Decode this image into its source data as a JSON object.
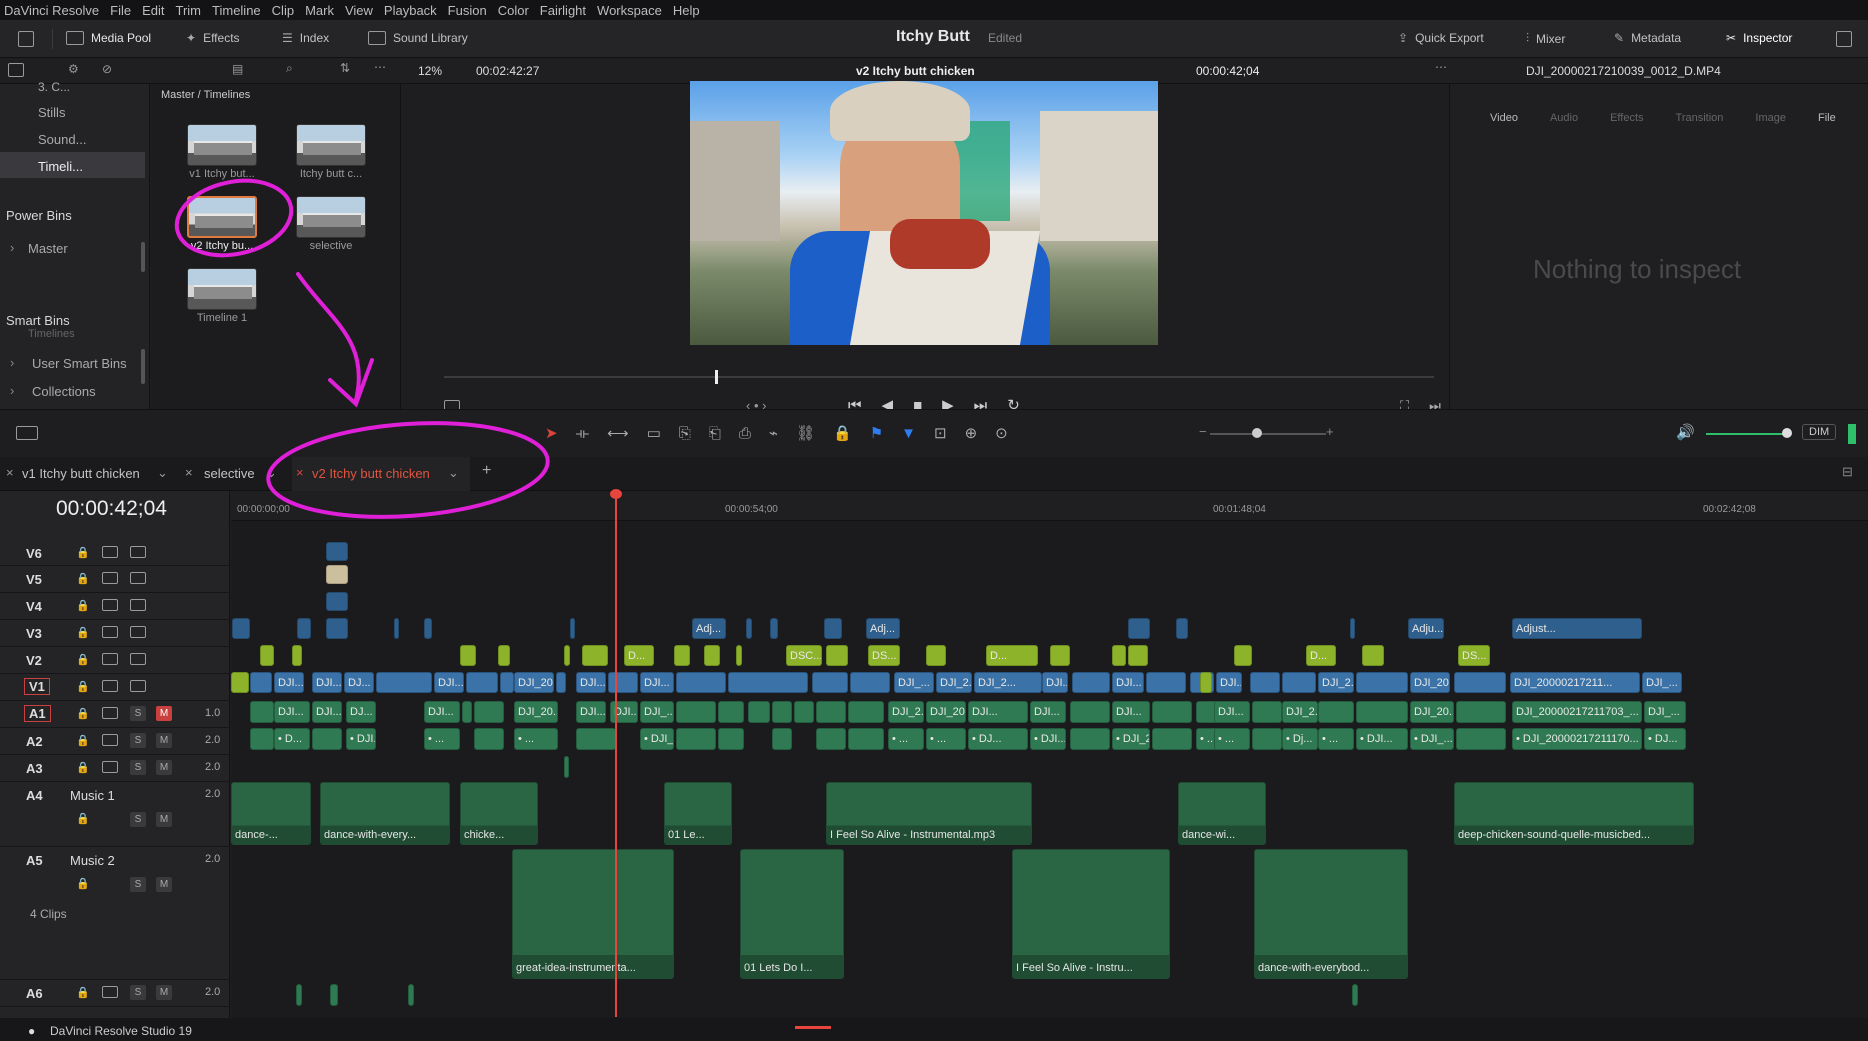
{
  "menu": [
    "DaVinci Resolve",
    "File",
    "Edit",
    "Trim",
    "Timeline",
    "Clip",
    "Mark",
    "View",
    "Playback",
    "Fusion",
    "Color",
    "Fairlight",
    "Workspace",
    "Help"
  ],
  "toolbar": {
    "media_pool": "Media Pool",
    "effects": "Effects",
    "index": "Index",
    "sound_library": "Sound Library",
    "project_title": "Itchy Butt",
    "project_status": "Edited",
    "quick_export": "Quick Export",
    "mixer": "Mixer",
    "metadata": "Metadata",
    "inspector": "Inspector"
  },
  "subbar": {
    "zoom": "12%",
    "source_timecode": "00:02:42:27",
    "timeline_name": "v2 Itchy butt chicken",
    "record_timecode": "00:00:42;04",
    "clip_name": "DJI_20000217210039_0012_D.MP4"
  },
  "sidebar": {
    "item_top": "3. C...",
    "stills": "Stills",
    "sound": "Sound...",
    "timelines": "Timeli...",
    "power_bins": "Power Bins",
    "master": "Master",
    "smart_bins": "Smart Bins",
    "user_smart_bins": "User Smart Bins",
    "collections": "Collections",
    "timelines_hidden": "Timelines"
  },
  "pool": {
    "path": "Master / Timelines",
    "items": [
      "v1 Itchy but...",
      "Itchy butt c...",
      "v2 Itchy bu...",
      "selective",
      "Timeline 1"
    ]
  },
  "inspector_panel": {
    "tabs": [
      "Video",
      "Audio",
      "Effects",
      "Transition",
      "Image",
      "File"
    ],
    "empty": "Nothing to inspect"
  },
  "timeline_tools": {
    "dim": "DIM"
  },
  "tabs": {
    "tab1": "v1 Itchy butt chicken",
    "tab2": "selective",
    "tab3": "v2 Itchy butt chicken",
    "add": "+"
  },
  "timecode": "00:00:42;04",
  "ruler": [
    "00:00:00;00",
    "00:00:54;00",
    "00:01:48;04",
    "00:02:42;08"
  ],
  "tracks": {
    "V6": "V6",
    "V5": "V5",
    "V4": "V4",
    "V3": "V3",
    "V2": "V2",
    "V1": "V1",
    "A1": "A1",
    "A2": "A2",
    "A3": "A3",
    "A4": "A4",
    "A5": "A5",
    "A6": "A6",
    "a1_level": "1.0",
    "a2_level": "2.0",
    "a3_level": "2.0",
    "a4_level": "2.0",
    "a5_level": "2.0",
    "a6_level": "2.0",
    "a4_name": "Music 1",
    "a5_name": "Music 2",
    "a5_clips": "4 Clips"
  },
  "clip_labels": {
    "adj1": "Adj...",
    "adj2": "Adj...",
    "adju": "Adju...",
    "adjust": "Adjust...",
    "v2_d1": "D...",
    "v2_dsc": "DSC...",
    "v2_ds": "DS...",
    "v2_d2": "D...",
    "v2_d3": "D...",
    "v2_d4": "D...",
    "v2_ds2": "DS...",
    "v1_1": "DJI...",
    "v1_2": "DJI...",
    "v1_3": "DJ...",
    "v1_4": "DJI...",
    "v1_5": "DJI_20...",
    "v1_6": "DJI...",
    "v1_7": "DJI...",
    "v1_8": "DJI_...",
    "v1_9": "DJI_2...",
    "v1_10": "DJI_2...",
    "v1_11": "DJI...",
    "v1_12": "DJI...",
    "v1_13": "DJI...",
    "v1_14": "DJI_2...",
    "v1_15": "DJI_20...",
    "v1_16": "DJI_20000217211...",
    "v1_17": "DJI_...",
    "a1_1": "DJI...",
    "a1_2": "DJI...",
    "a1_3": "DJ...",
    "a1_4": "DJI...",
    "a1_5": "DJI_20...",
    "a1_6": "DJI...",
    "a1_7": "DJI...",
    "a1_8": "DJI_...",
    "a1_9": "DJI_2...",
    "a1_10": "DJI_2000...",
    "a1_11": "DJI...",
    "a1_12": "DJI...",
    "a1_13": "DJI...",
    "a1_14": "DJI...",
    "a1_15": "DJI_2...",
    "a1_16": "DJI_20...",
    "a1_17": "DJI_20000217211703_...",
    "a1_18": "DJI_...",
    "a2_1": "• D...",
    "a2_2": "• DJI...",
    "a2_3": "• ...",
    "a2_4": "• ...",
    "a2_5": "• DJI_...",
    "a2_6": "• ...",
    "a2_7": "• ...",
    "a2_8": "• DJ...",
    "a2_9": "• DJI...",
    "a2_10": "• DJI_200...",
    "a2_11": "• ...",
    "a2_12": "• ...",
    "a2_13": "• Dj...",
    "a2_14": "• ...",
    "a2_15": "• DJI...",
    "a2_16": "• DJI_...",
    "a2_17": "• DJI_20000217211170...",
    "a2_18": "• DJ...",
    "m1": "dance-...",
    "m2": "dance-with-every...",
    "m3": "chicke...",
    "m4": "01 Le...",
    "m5": "I Feel So Alive - Instrumental.mp3",
    "m6": "dance-wi...",
    "m7": "deep-chicken-sound-quelle-musicbed...",
    "n1": "great-idea-instrumenta...",
    "n2": "01 Lets Do I...",
    "n3": "I Feel So Alive - Instru...",
    "n4": "dance-with-everybod..."
  },
  "status": "DaVinci Resolve Studio 19"
}
